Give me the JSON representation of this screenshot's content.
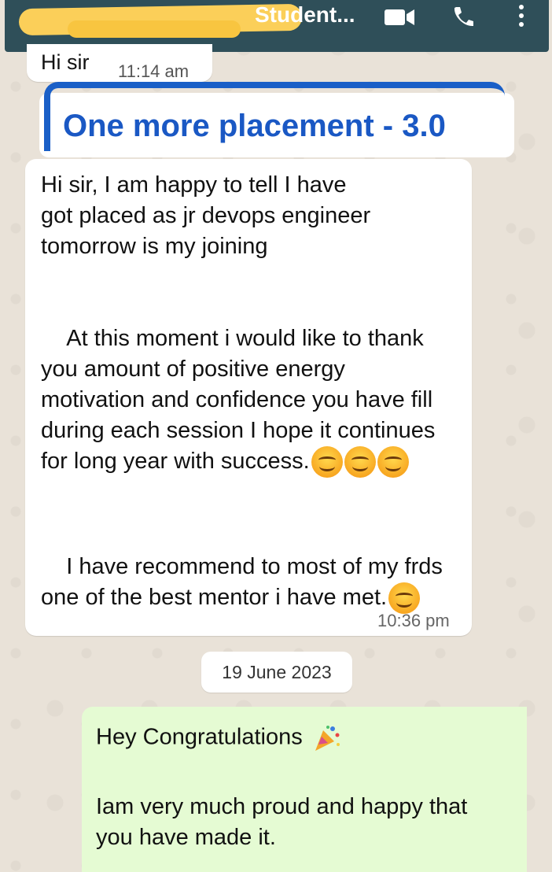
{
  "header": {
    "contact_name": "Student..."
  },
  "previous_message": {
    "text": "Hi sir",
    "time": "11:14 am"
  },
  "headline": {
    "text": "One more placement - 3.0",
    "color": "#1a58c4"
  },
  "incoming_message": {
    "paragraph1": "Hi sir, I am happy to tell I have\ngot placed as jr devops engineer\ntomorrow is my joining",
    "paragraph2": "At this moment i would like to thank you amount of positive energy  motivation and confidence you have fill during each session I hope it continues for long year with success.",
    "paragraph3": "I have recommend to most of my frds one of the best mentor i have met.",
    "time": "10:36 pm"
  },
  "date_divider": "19 June 2023",
  "outgoing_message": {
    "line1": "Hey Congratulations",
    "paragraph2": "Iam very much proud and happy that you have made it."
  },
  "colors": {
    "topbar": "#2f4f59",
    "outgoing_bubble": "#e5fbd3",
    "accent": "#1a5fc7"
  }
}
